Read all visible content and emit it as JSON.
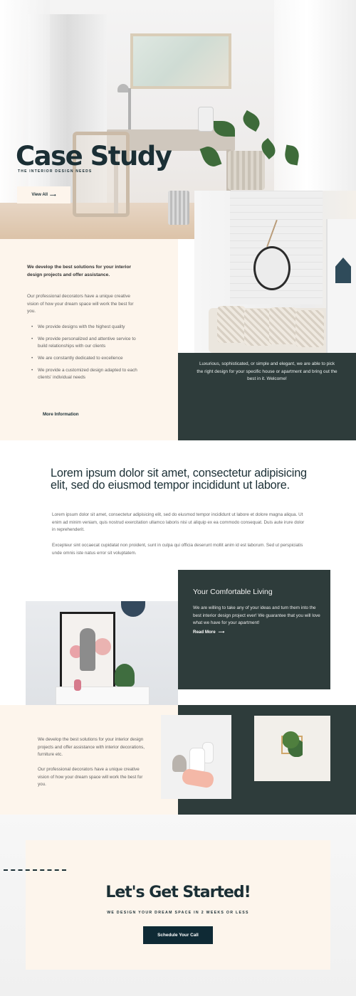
{
  "hero": {
    "title": "Case Study",
    "subtitle": "THE INTERIOR DESIGN NEEDS",
    "button_label": "View All",
    "button_arrow": "⟶"
  },
  "intro": {
    "strong": "We develop the best solutions for your interior design projects and offer assistance.",
    "paragraph": "Our professional decorators have a unique creative vision of how your dream space will work the best for you.",
    "list": [
      "We provide designs with the highest quality",
      "We provide personalized and attentive service to build relationships with our clients",
      "We are constantly dedicated to excellence",
      "We provide a customized design adapted to each clients' individual needs"
    ],
    "link_label": "More Information",
    "quote": "Luxurious, sophisticated, or simple and elegant, we are able to pick the right design for your specific house or apartment and bring out the best in it. Welcome!"
  },
  "lorem": {
    "heading": "Lorem ipsum dolor sit amet, consectetur adipisicing elit, sed do eiusmod tempor incididunt ut labore.",
    "p1": "Lorem ipsum dolor sit amet, consectetur adipisicing elit, sed do eiusmod tempor incididunt ut labore et dolore magna aliqua. Ut enim ad minim veniam, quis nostrud exercitation ullamco laboris nisi ut aliquip ex ea commodo consequat. Duis aute irure dolor in reprehenderit.",
    "p2": "Excepteur sint occaecat cupidatat non proident, sunt in culpa qui officia deserunt mollit anim id est laborum. Sed ut perspiciatis unde omnis iste natus error sit voluptatem."
  },
  "comfort": {
    "heading": "Your Comfortable Living",
    "paragraph": "We are willing to take any of your ideas and turn them into the best interior design project ever! We guarantee that you will love what we have for your apartment!",
    "link_label": "Read More",
    "link_arrow": "⟶"
  },
  "band": {
    "p1": "We develop the best solutions for your interior design projects and offer assistance with interior decorations, furniture etc.",
    "p2": "Our professional decorators have a unique creative vision of how your dream space will work the best for you."
  },
  "cta": {
    "heading": "Let's Get Started!",
    "subtitle": "WE DESIGN YOUR DREAM SPACE IN 2 WEEKS OR LESS",
    "button_label": "Schedule Your Call"
  },
  "colors": {
    "dark": "#2e3c3b",
    "navy": "#1b2f35",
    "peach": "#fdf5ec"
  }
}
